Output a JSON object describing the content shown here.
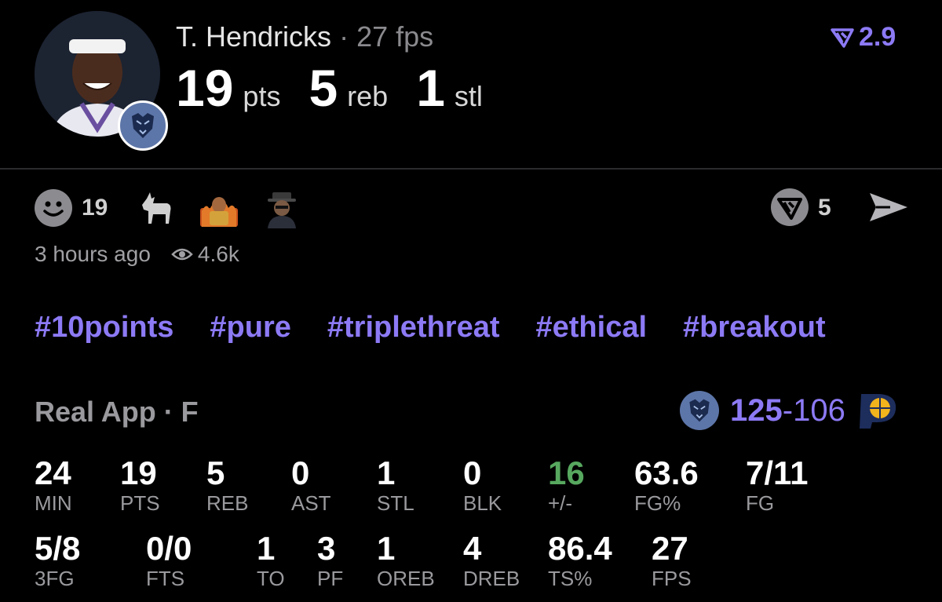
{
  "header": {
    "player_name": "T. Hendricks",
    "separator": " · ",
    "player_fps": "27 fps",
    "stats": [
      {
        "value": "19",
        "label": "pts"
      },
      {
        "value": "5",
        "label": "reb"
      },
      {
        "value": "1",
        "label": "stl"
      }
    ],
    "rating": "2.9"
  },
  "reactions": {
    "smile_count": "19",
    "items": [
      "goat-reaction",
      "fire-guy-reaction",
      "hat-guy-reaction"
    ],
    "real_count": "5"
  },
  "meta": {
    "time_ago": "3 hours ago",
    "views": "4.6k"
  },
  "hashtags": [
    "#10points",
    "#pure",
    "#triplethreat",
    "#ethical",
    "#breakout"
  ],
  "game": {
    "source": "Real App · F",
    "score_team": "125",
    "score_dash": "-",
    "score_opp": "106"
  },
  "box_score": {
    "row1": [
      {
        "value": "24",
        "label": "MIN"
      },
      {
        "value": "19",
        "label": "PTS"
      },
      {
        "value": "5",
        "label": "REB"
      },
      {
        "value": "0",
        "label": "AST"
      },
      {
        "value": "1",
        "label": "STL"
      },
      {
        "value": "0",
        "label": "BLK"
      },
      {
        "value": "16",
        "label": "+/-"
      },
      {
        "value": "63.6",
        "label": "FG%"
      },
      {
        "value": "7/11",
        "label": "FG"
      }
    ],
    "row2": [
      {
        "value": "5/8",
        "label": "3FG"
      },
      {
        "value": "0/0",
        "label": "FTS"
      },
      {
        "value": "1",
        "label": "TO"
      },
      {
        "value": "3",
        "label": "PF"
      },
      {
        "value": "1",
        "label": "OREB"
      },
      {
        "value": "4",
        "label": "DREB"
      },
      {
        "value": "86.4",
        "label": "TS%"
      },
      {
        "value": "27",
        "label": "FPS"
      }
    ]
  },
  "colors": {
    "accent": "#8c7af5",
    "positive": "#57a85f",
    "muted": "#9a9a9e",
    "background": "#000000"
  }
}
